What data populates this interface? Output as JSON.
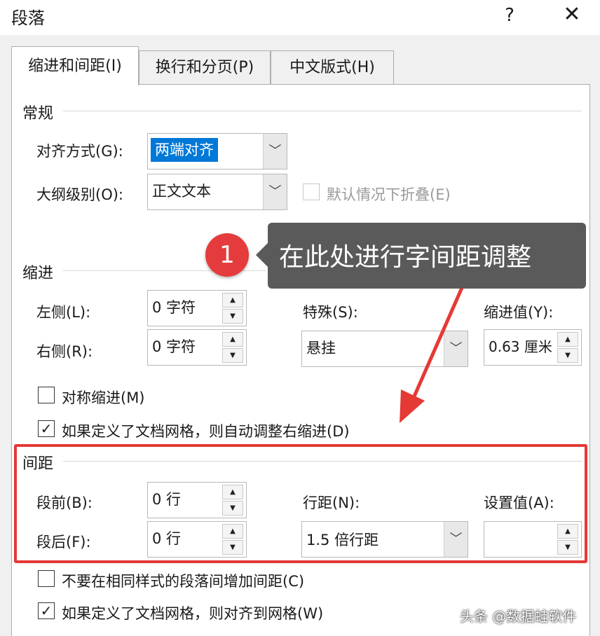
{
  "window": {
    "title": "段落",
    "help_label": "?",
    "close_label": "✕"
  },
  "tabs": [
    {
      "label": "缩进和间距(I)",
      "active": true
    },
    {
      "label": "换行和分页(P)",
      "active": false
    },
    {
      "label": "中文版式(H)",
      "active": false
    }
  ],
  "general": {
    "section_title": "常规",
    "alignment_label": "对齐方式(G):",
    "alignment_value": "两端对齐",
    "outline_label": "大纲级别(O):",
    "outline_value": "正文文本",
    "collapse_label": "默认情况下折叠(E)"
  },
  "indent": {
    "section_title": "缩进",
    "left_label": "左侧(L):",
    "left_value": "0 字符",
    "right_label": "右侧(R):",
    "right_value": "0 字符",
    "special_label": "特殊(S):",
    "special_value": "悬挂",
    "indent_value_label": "缩进值(Y):",
    "indent_value": "0.63 厘米",
    "mirror_label": "对称缩进(M)",
    "mirror_checked": false,
    "auto_adjust_label": "如果定义了文档网格，则自动调整右缩进(D)",
    "auto_adjust_checked": true
  },
  "spacing": {
    "section_title": "间距",
    "before_label": "段前(B):",
    "before_value": "0 行",
    "after_label": "段后(F):",
    "after_value": "0 行",
    "line_spacing_label": "行距(N):",
    "line_spacing_value": "1.5 倍行距",
    "set_value_label": "设置值(A):",
    "set_value": "",
    "no_space_label": "不要在相同样式的段落间增加间距(C)",
    "no_space_checked": false,
    "snap_grid_label": "如果定义了文档网格，则对齐到网格(W)",
    "snap_grid_checked": true
  },
  "annotation": {
    "badge": "1",
    "callout_text": "在此处进行字间距调整",
    "highlight_color": "#e53935",
    "badge_color": "#e43c3c"
  },
  "watermark": "头条 @数据蛙软件"
}
